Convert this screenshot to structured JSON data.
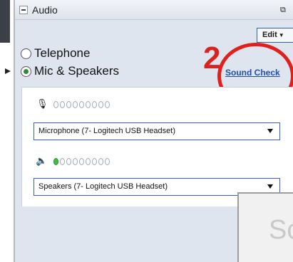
{
  "panel": {
    "title": "Audio",
    "edit_label": "Edit",
    "annotation_number": "2"
  },
  "audio": {
    "options": [
      {
        "label": "Telephone",
        "selected": false
      },
      {
        "label": "Mic & Speakers",
        "selected": true
      }
    ],
    "sound_check_label": "Sound Check",
    "microphone": {
      "level_dots": 9,
      "lit_dots": 0,
      "device": "Microphone (7- Logitech USB Headset)"
    },
    "speakers": {
      "level_dots": 9,
      "lit_dots": 1,
      "device": "Speakers (7- Logitech USB Headset)"
    }
  },
  "background_window": {
    "text": "Sc"
  },
  "icons": {
    "collapse": "minus-box-icon",
    "corner": "popout-icon",
    "microphone": "microphone-icon",
    "speaker": "speaker-icon",
    "dropdown": "chevron-down-icon",
    "pointer": "arrow-pointer-icon"
  },
  "colors": {
    "accent_blue": "#3963b8",
    "link_blue": "#1f4fae",
    "annotation_red": "#d8231e",
    "level_green": "#3fbf3f"
  }
}
